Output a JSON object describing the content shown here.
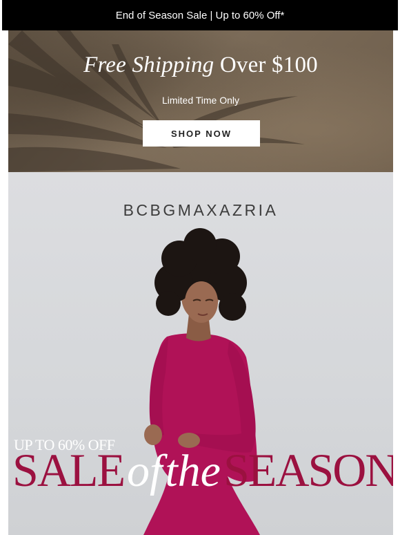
{
  "announcement": {
    "text": "End of Season Sale | Up to 60% Off*"
  },
  "shipping_banner": {
    "title_italic": "Free Shipping",
    "title_rest": "Over $100",
    "subtitle": "Limited Time Only",
    "button_label": "SHOP NOW"
  },
  "hero": {
    "brand": "BCBGMAXAZRIA",
    "promo_small": "UP TO 60% OFF",
    "headline_word1": "SALE",
    "headline_word2": "of",
    "headline_word3": "the",
    "headline_word4": "SEASON"
  },
  "colors": {
    "announcement_bg": "#000000",
    "accent_magenta": "#9b1140",
    "dress": "#b01257",
    "hero_bg": "#d8d9dc"
  }
}
